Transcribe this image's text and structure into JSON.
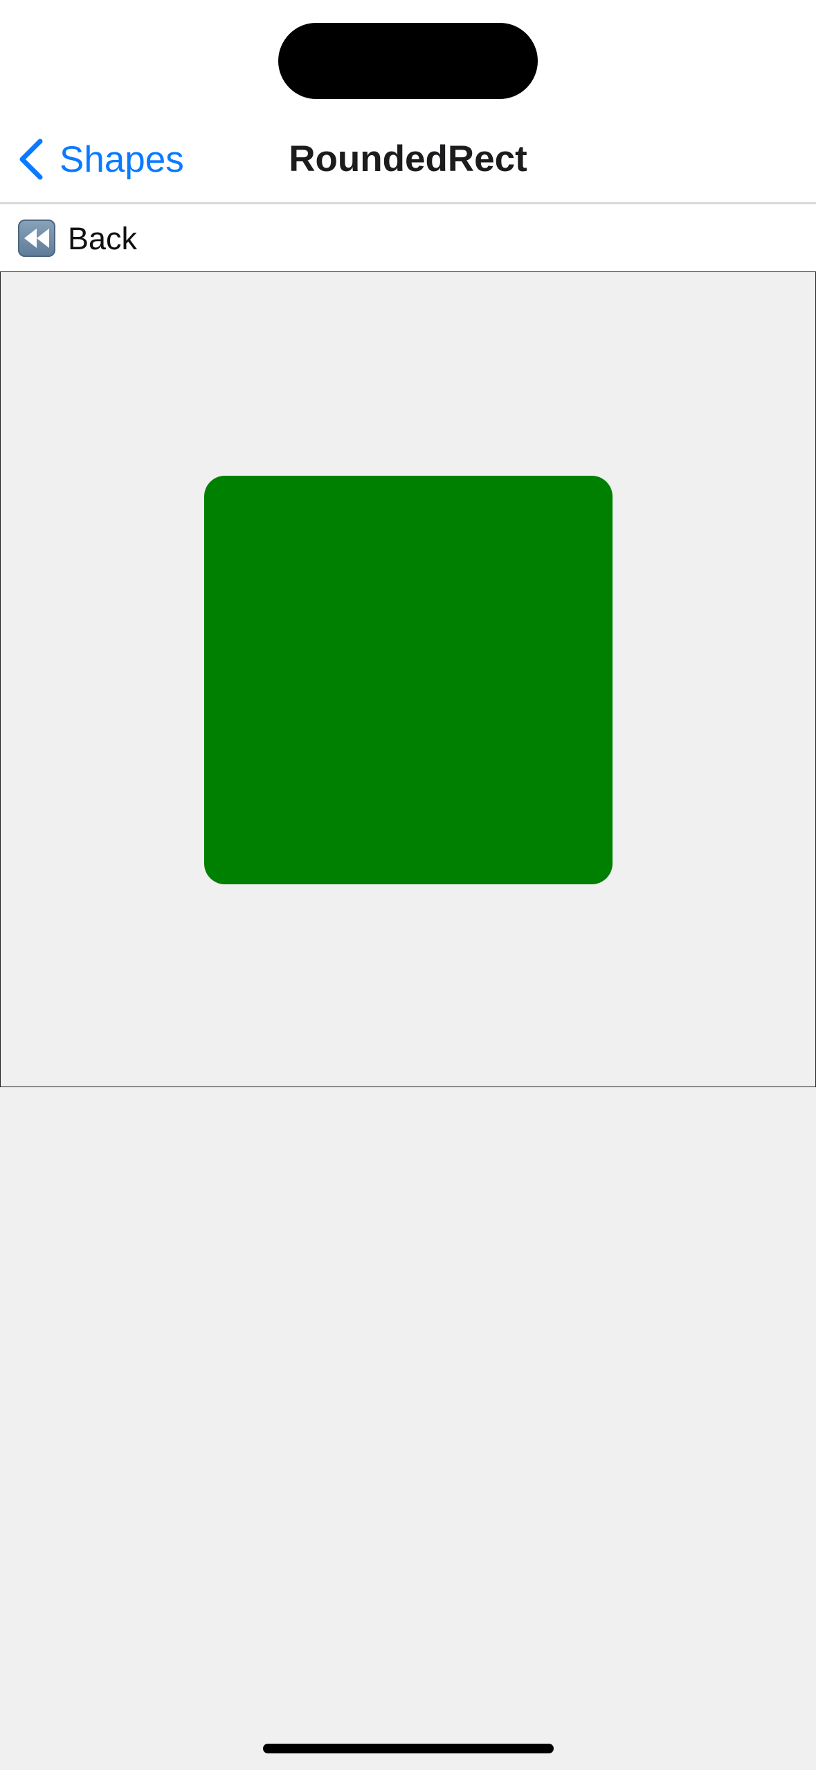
{
  "nav": {
    "back_label": "Shapes",
    "title": "RoundedRect"
  },
  "toolbar": {
    "back_label": "Back",
    "back_icon": "rewind-icon"
  },
  "shape": {
    "type": "rounded-rect",
    "color": "#008000"
  },
  "colors": {
    "accent": "#0a7aff",
    "canvas_background": "#f0f0f0"
  }
}
